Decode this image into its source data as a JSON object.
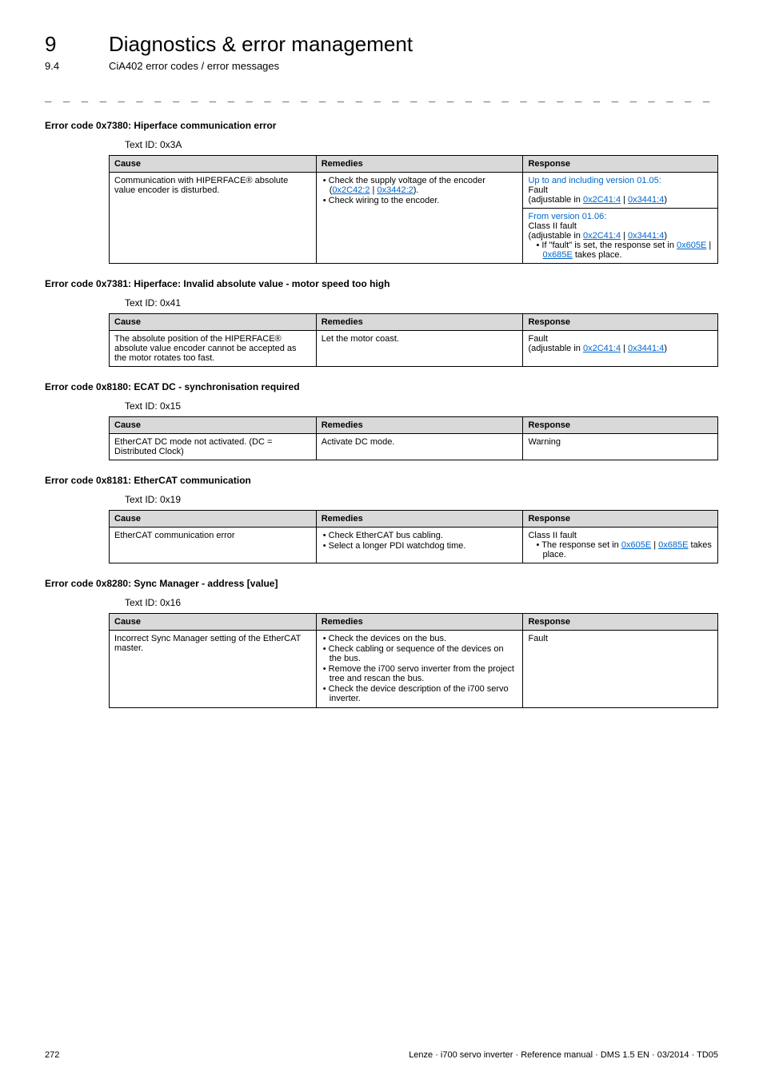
{
  "header": {
    "chapter_num": "9",
    "chapter_title": "Diagnostics & error management",
    "section_num": "9.4",
    "section_title": "CiA402 error codes / error messages"
  },
  "separator": "_ _ _ _ _ _ _ _ _ _ _ _ _ _ _ _ _ _ _ _ _ _ _ _ _ _ _ _ _ _ _ _ _ _ _ _ _ _ _ _ _ _ _ _ _ _ _ _ _ _ _ _ _ _ _ _ _ _ _ _ _ _ _ _",
  "table_headers": {
    "cause": "Cause",
    "remedies": "Remedies",
    "response": "Response"
  },
  "errors": [
    {
      "title": "Error code 0x7380: Hiperface communication error",
      "text_id": "Text ID: 0x3A",
      "rows": [
        {
          "cause": "Communication with HIPERFACE® absolute value encoder is disturbed.",
          "remedies": [
            {
              "pre": "Check the supply voltage of the encoder (",
              "links": [
                "0x2C42:2",
                "0x3442:2"
              ],
              "post": ")."
            },
            {
              "pre": "Check wiring to the encoder."
            }
          ],
          "response_multi": [
            {
              "line1_pre": "Up to and including version 01.05:",
              "line2": "Fault",
              "line3_pre": "(adjustable in ",
              "line3_links": [
                "0x2C41:4",
                "0x3441:4"
              ],
              "line3_post": ")"
            },
            {
              "line1_pre": "From version 01.06:",
              "line2": "Class II fault",
              "line3_pre": "(adjustable in ",
              "line3_links": [
                "0x2C41:4",
                "0x3441:4"
              ],
              "line3_post": ")",
              "bullet_pre": "If \"fault\" is set, the response set in ",
              "bullet_links": [
                "0x605E",
                "0x685E"
              ],
              "bullet_post": " takes place."
            }
          ]
        }
      ]
    },
    {
      "title": "Error code 0x7381: Hiperface: Invalid absolute value - motor speed too high",
      "text_id": "Text ID: 0x41",
      "rows": [
        {
          "cause": "The absolute position of the HIPERFACE® absolute value encoder cannot be accepted as the motor rotates too fast.",
          "remedies_plain": "Let the motor coast.",
          "response_simple": {
            "line1": "Fault",
            "line2_pre": "(adjustable in ",
            "line2_links": [
              "0x2C41:4",
              "0x3441:4"
            ],
            "line2_post": ")"
          }
        }
      ]
    },
    {
      "title": "Error code 0x8180: ECAT DC - synchronisation required",
      "text_id": "Text ID: 0x15",
      "rows": [
        {
          "cause": "EtherCAT DC mode not activated. (DC = Distributed Clock)",
          "remedies_plain": "Activate DC mode.",
          "response_plain": "Warning"
        }
      ]
    },
    {
      "title": "Error code 0x8181: EtherCAT communication",
      "text_id": "Text ID: 0x19",
      "rows": [
        {
          "cause": "EtherCAT communication error",
          "remedies": [
            {
              "pre": "Check EtherCAT bus cabling."
            },
            {
              "pre": "Select a longer PDI watchdog time."
            }
          ],
          "response_class": {
            "line1": "Class II fault",
            "bullet_pre": "The response set in ",
            "bullet_links": [
              "0x605E",
              "0x685E"
            ],
            "bullet_post": " takes place."
          }
        }
      ]
    },
    {
      "title": "Error code 0x8280: Sync Manager - address [value]",
      "text_id": "Text ID: 0x16",
      "rows": [
        {
          "cause": "Incorrect Sync Manager setting of the EtherCAT master.",
          "remedies": [
            {
              "pre": "Check the devices on the bus."
            },
            {
              "pre": "Check cabling or sequence of the devices on the bus."
            },
            {
              "pre": "Remove the i700 servo inverter from the project tree and rescan the bus."
            },
            {
              "pre": "Check the device description of the i700 servo inverter."
            }
          ],
          "response_plain": "Fault"
        }
      ]
    }
  ],
  "footer": {
    "page": "272",
    "info": "Lenze · i700 servo inverter · Reference manual · DMS 1.5 EN · 03/2014 · TD05"
  }
}
